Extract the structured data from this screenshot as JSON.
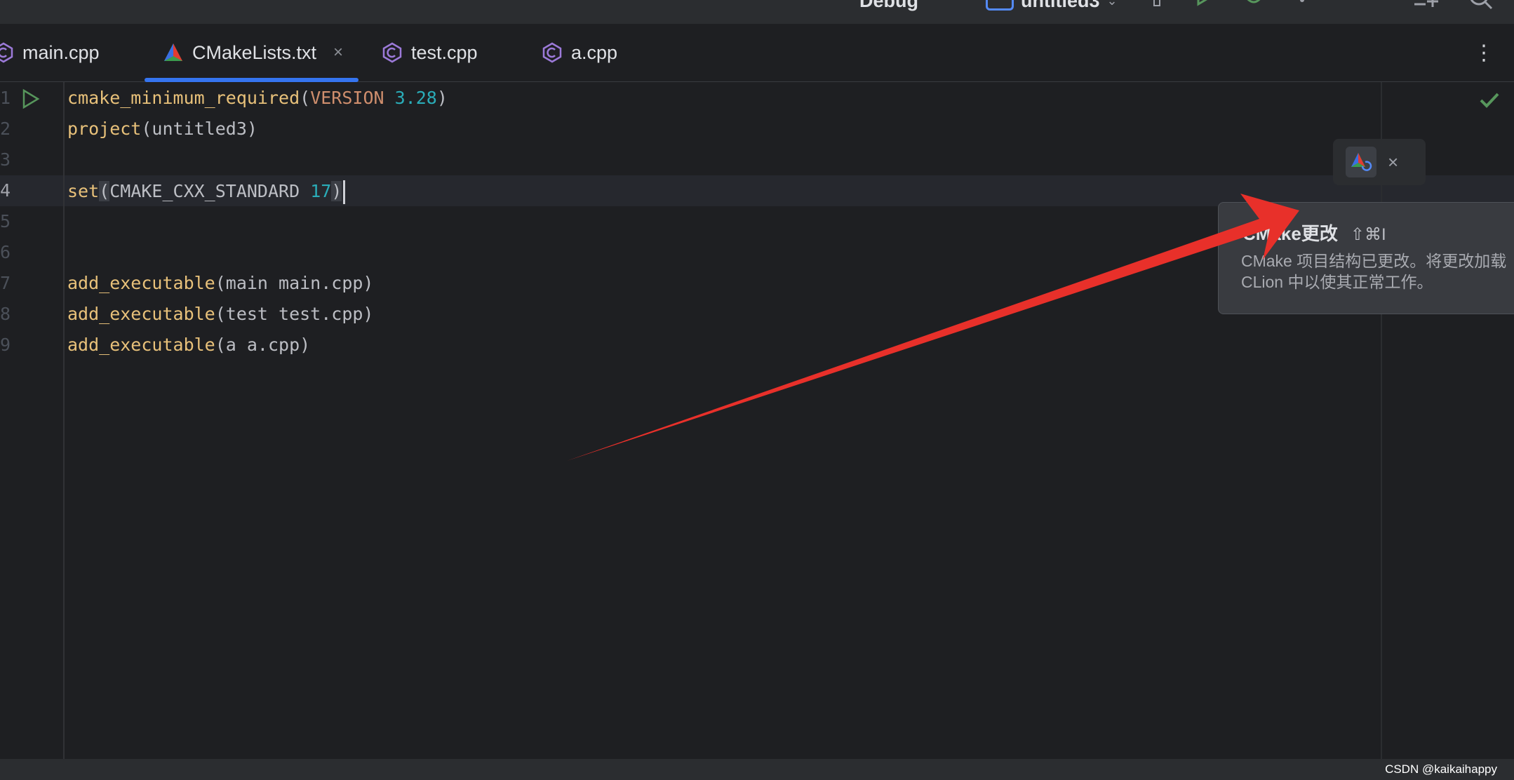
{
  "toolbar": {
    "run_config": "Debug",
    "project_name": "untitled3",
    "chevron": "⌄"
  },
  "tabs": [
    {
      "label": "main.cpp",
      "icon": "cpp-file-icon"
    },
    {
      "label": "CMakeLists.txt",
      "icon": "cmake-icon",
      "active": true,
      "close": "×"
    },
    {
      "label": "test.cpp",
      "icon": "cpp-file-icon"
    },
    {
      "label": "a.cpp",
      "icon": "cpp-file-icon"
    }
  ],
  "tab_menu": "⋮",
  "editor": {
    "line_numbers": [
      "1",
      "2",
      "3",
      "4",
      "5",
      "6",
      "7",
      "8",
      "9"
    ],
    "lines": {
      "l1": {
        "fn": "cmake_minimum_required",
        "open": "(",
        "kw": "VERSION",
        "sp": " ",
        "num": "3.28",
        "close": ")"
      },
      "l2": {
        "fn": "project",
        "rest": "(untitled3)"
      },
      "l4": {
        "fn": "set",
        "open": "(",
        "arg": "CMAKE_CXX_STANDARD ",
        "num": "17",
        "close": ")"
      },
      "l7": {
        "fn": "add_executable",
        "rest": "(main main.cpp)"
      },
      "l8": {
        "fn": "add_executable",
        "rest": "(test test.cpp)"
      },
      "l9": {
        "fn": "add_executable",
        "rest": "(a a.cpp)"
      }
    }
  },
  "reload_popup": {
    "close": "×"
  },
  "tooltip": {
    "title": "CMake更改",
    "shortcut": "⇧⌘I",
    "desc_line1": "CMake 项目结构已更改。将更改加载",
    "desc_line2": "CLion 中以使其正常工作。"
  },
  "watermark": "CSDN @kaikaihappy",
  "colors": {
    "accent": "#3574f0",
    "arrow": "#e8302a",
    "function": "#e8c17a",
    "keyword": "#cf8e6d",
    "number": "#2aacb8"
  }
}
